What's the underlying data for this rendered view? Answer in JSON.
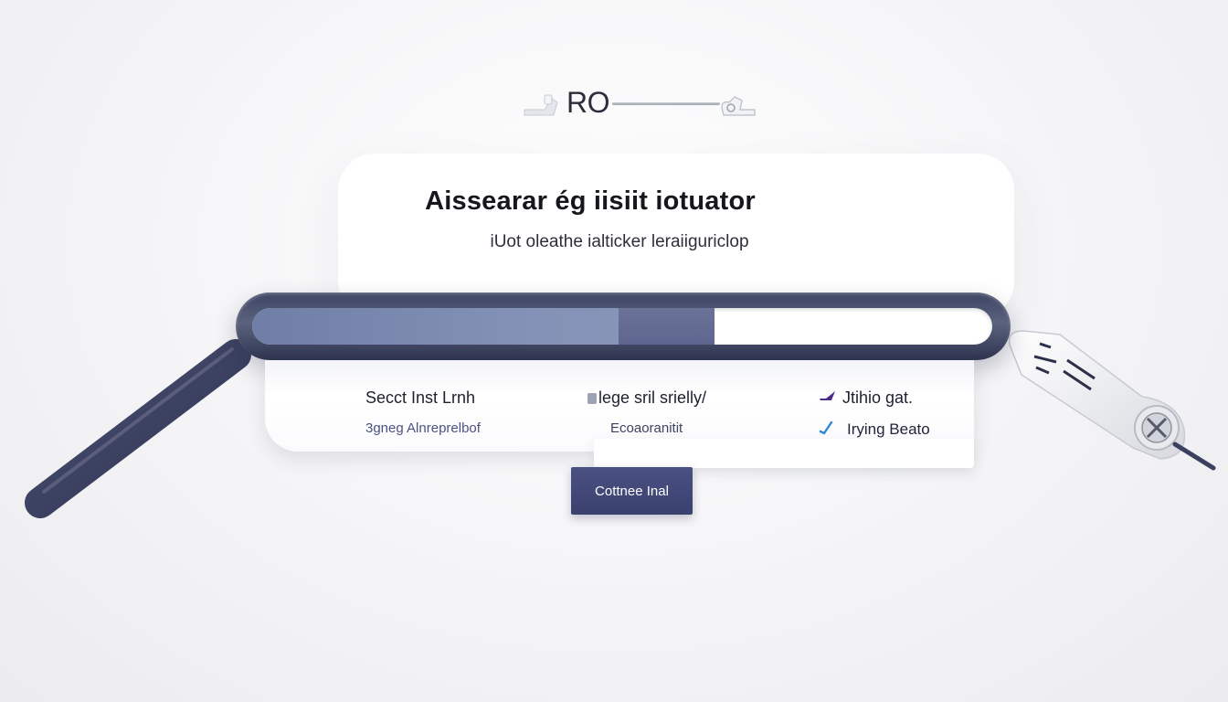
{
  "logo": {
    "text": "RO"
  },
  "header": {
    "title": "Aissearar ég iisiit iotuator",
    "subtitle": "iUot oleathe ialticker leraiiguriclop"
  },
  "progress": {
    "fill_fraction": 0.625,
    "tip_fraction": 0.13,
    "colors": {
      "track": "#3e4563",
      "fill": "#8392b6",
      "tip": "#6a7298"
    }
  },
  "options": {
    "col1": {
      "title": "Secct Inst Lrnh",
      "sub": "3gneg Alnreprelbof"
    },
    "col2": {
      "title": "lege sril srielly/",
      "sub": "Ecoaoranitit"
    },
    "col3": {
      "title": "Jtihio gat.",
      "sub": "Irying Beato",
      "check1_color": "#4b2c8c",
      "check2_color": "#2f86d6"
    }
  },
  "buttons": {
    "continue_label": "Cottnee Inal"
  },
  "icons": {
    "left_handle": "handle-icon",
    "right_handle": "clamp-icon",
    "logo_left": "logo-mark-icon",
    "logo_right": "logo-mark-icon"
  },
  "colors": {
    "button": "#3a416f",
    "handle": "#3c4162"
  }
}
